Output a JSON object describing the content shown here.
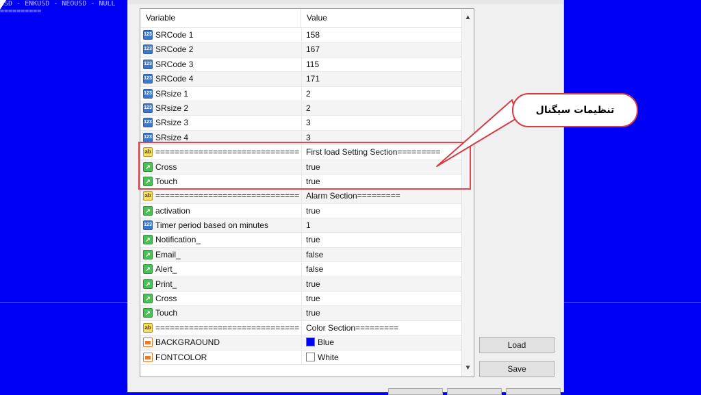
{
  "background": {
    "title_text": "USD - ENKUSD - NEOUSD - NULL",
    "sep_text": "==========",
    "color": "#0000f4"
  },
  "grid": {
    "columns": [
      "Variable",
      "Value"
    ],
    "rows": [
      {
        "type": "num",
        "name": "SRCode 1",
        "value": "158"
      },
      {
        "type": "num",
        "name": "SRCode 2",
        "value": "167"
      },
      {
        "type": "num",
        "name": "SRCode 3",
        "value": "115"
      },
      {
        "type": "num",
        "name": "SRCode 4",
        "value": "171"
      },
      {
        "type": "num",
        "name": "SRsize 1",
        "value": "2"
      },
      {
        "type": "num",
        "name": "SRsize 2",
        "value": "2"
      },
      {
        "type": "num",
        "name": "SRsize 3",
        "value": "3"
      },
      {
        "type": "num",
        "name": "SRsize 4",
        "value": "3"
      },
      {
        "type": "ab",
        "name": "================================",
        "value": "First load Setting Section========="
      },
      {
        "type": "bool",
        "name": "Cross",
        "value": "true"
      },
      {
        "type": "bool",
        "name": "Touch",
        "value": "true"
      },
      {
        "type": "ab",
        "name": "================================",
        "value": "Alarm Section========="
      },
      {
        "type": "bool",
        "name": "activation",
        "value": "true"
      },
      {
        "type": "num",
        "name": "Timer period based on minutes",
        "value": "1"
      },
      {
        "type": "bool",
        "name": "Notification_",
        "value": "true"
      },
      {
        "type": "bool",
        "name": "Email_",
        "value": "false"
      },
      {
        "type": "bool",
        "name": "Alert_",
        "value": "false"
      },
      {
        "type": "bool",
        "name": "Print_",
        "value": "true"
      },
      {
        "type": "bool",
        "name": "Cross",
        "value": "true"
      },
      {
        "type": "bool",
        "name": "Touch",
        "value": "true"
      },
      {
        "type": "ab",
        "name": "================================",
        "value": "Color Section========="
      },
      {
        "type": "color",
        "name": "BACKGRAOUND",
        "value": "Blue",
        "swatch": "#0000ff"
      },
      {
        "type": "color",
        "name": "FONTCOLOR",
        "value": "White",
        "swatch": "#ffffff"
      }
    ]
  },
  "icons": {
    "num": "123",
    "ab": "ab",
    "bool": "↗"
  },
  "buttons": {
    "load": "Load",
    "save": "Save"
  },
  "annotation": {
    "callout_text": "تنظیمات سیگنال",
    "accent": "#e2454c"
  }
}
